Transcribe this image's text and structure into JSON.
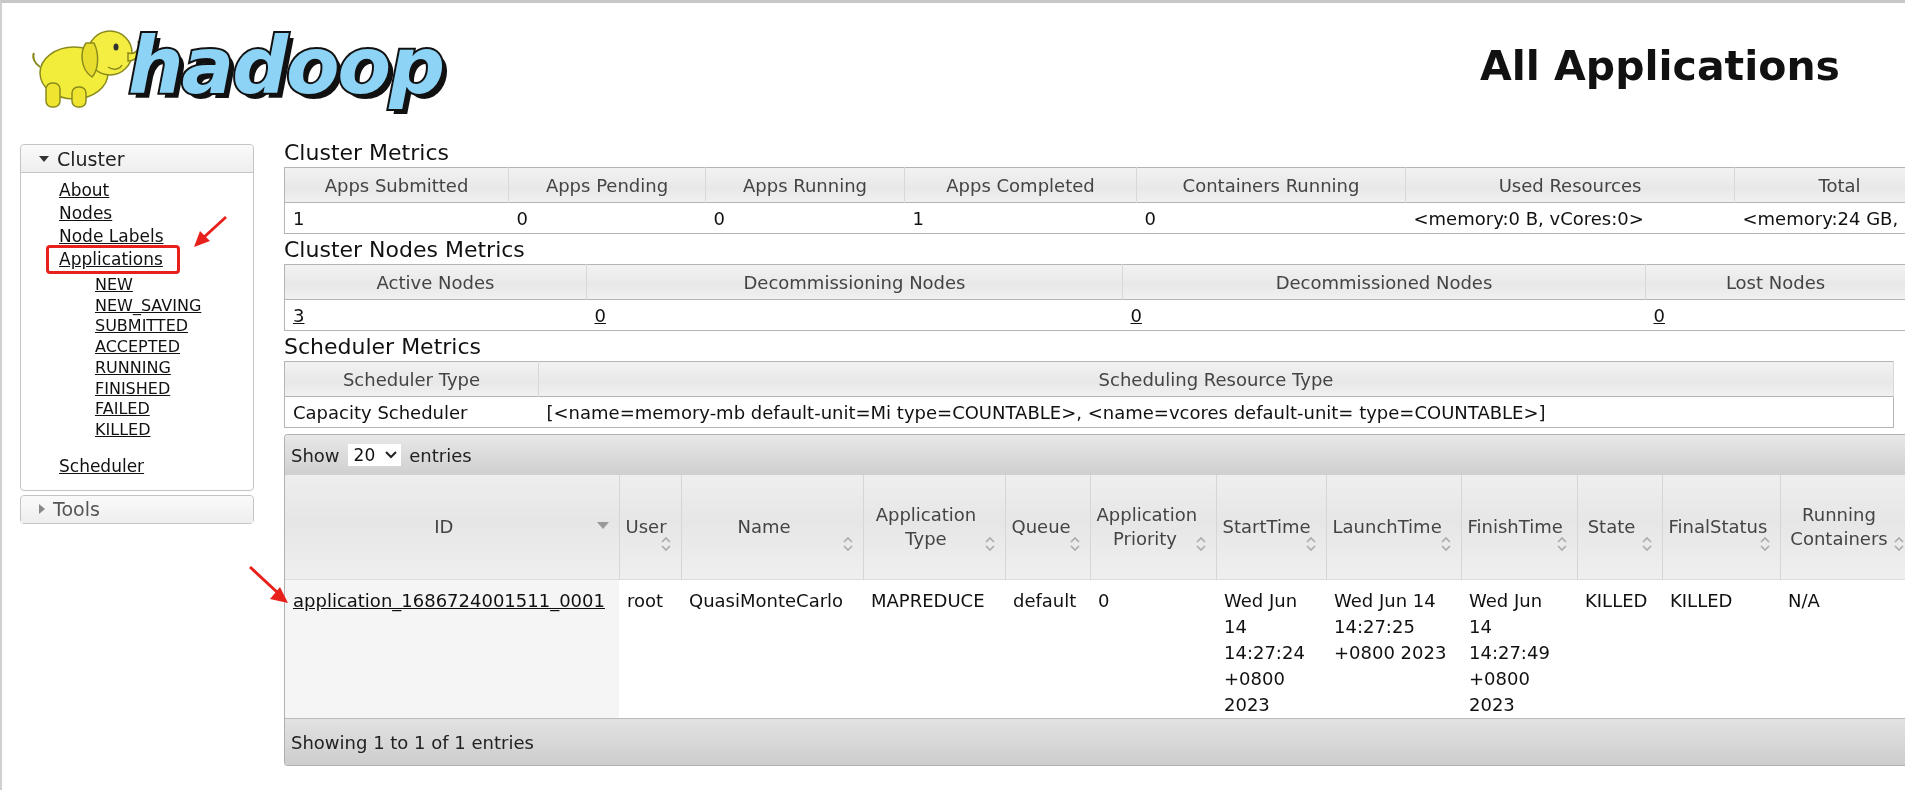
{
  "logo": {
    "text": "hadoop"
  },
  "page_title": "All Applications",
  "sidebar": [
    {
      "label": "Cluster",
      "expanded": true,
      "items": [
        {
          "label": "About",
          "highlighted": false
        },
        {
          "label": "Nodes",
          "highlighted": false
        },
        {
          "label": "Node Labels",
          "highlighted": false
        },
        {
          "label": "Applications",
          "highlighted": true,
          "children": [
            {
              "label": "NEW"
            },
            {
              "label": "NEW_SAVING"
            },
            {
              "label": "SUBMITTED"
            },
            {
              "label": "ACCEPTED"
            },
            {
              "label": "RUNNING"
            },
            {
              "label": "FINISHED"
            },
            {
              "label": "FAILED"
            },
            {
              "label": "KILLED"
            }
          ]
        },
        {
          "label": "Scheduler",
          "highlighted": false
        }
      ]
    },
    {
      "label": "Tools",
      "expanded": false
    }
  ],
  "metrics": [
    {
      "title": "Cluster Metrics",
      "linked_values": false,
      "columns": [
        "Apps Submitted",
        "Apps Pending",
        "Apps Running",
        "Apps Completed",
        "Containers Running",
        "Used Resources",
        "Total"
      ],
      "values": [
        "1",
        "0",
        "0",
        "1",
        "0",
        "<memory:0 B, vCores:0>",
        "<memory:24 GB,"
      ]
    },
    {
      "title": "Cluster Nodes Metrics",
      "linked_values": true,
      "columns": [
        "Active Nodes",
        "Decommissioning Nodes",
        "Decommissioned Nodes",
        "Lost Nodes"
      ],
      "values": [
        "3",
        "0",
        "0",
        "0"
      ]
    },
    {
      "title": "Scheduler Metrics",
      "linked_values": false,
      "columns": [
        "Scheduler Type",
        "Scheduling Resource Type"
      ],
      "values": [
        "Capacity Scheduler",
        "[<name=memory-mb default-unit=Mi type=COUNTABLE>, <name=vcores default-unit= type=COUNTABLE>]"
      ]
    }
  ],
  "apps_table": {
    "show_label": "Show",
    "page_size": "20",
    "entries_label": "entries",
    "columns": [
      {
        "label": "ID",
        "sorted": true
      },
      {
        "label": "User",
        "sorted": false
      },
      {
        "label": "Name",
        "sorted": false
      },
      {
        "label": "Application Type",
        "sorted": false
      },
      {
        "label": "Queue",
        "sorted": false
      },
      {
        "label": "Application Priority",
        "sorted": false
      },
      {
        "label": "StartTime",
        "sorted": false
      },
      {
        "label": "LaunchTime",
        "sorted": false
      },
      {
        "label": "FinishTime",
        "sorted": false
      },
      {
        "label": "State",
        "sorted": false
      },
      {
        "label": "FinalStatus",
        "sorted": false
      },
      {
        "label": "Running Containers",
        "sorted": false
      }
    ],
    "rows": [
      [
        "application_1686724001511_0001",
        "root",
        "QuasiMonteCarlo",
        "MAPREDUCE",
        "default",
        "0",
        "Wed Jun 14 14:27:24 +0800 2023",
        "Wed Jun 14 14:27:25 +0800 2023",
        "Wed Jun 14 14:27:49 +0800 2023",
        "KILLED",
        "KILLED",
        "N/A"
      ]
    ],
    "footer": "Showing 1 to 1 of 1 entries"
  }
}
